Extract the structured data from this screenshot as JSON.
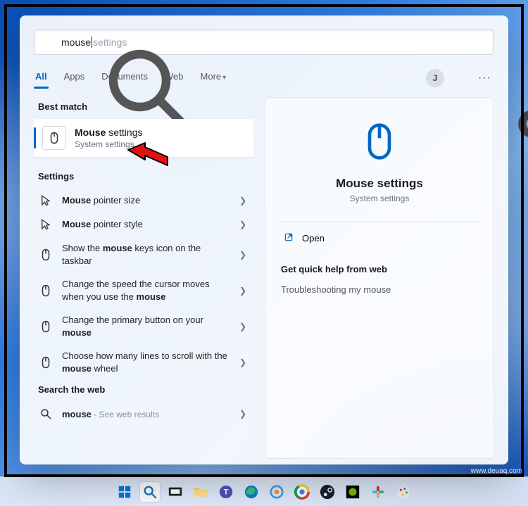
{
  "search": {
    "typed": "mouse",
    "hint_suffix": " settings"
  },
  "tabs": {
    "all": "All",
    "apps": "Apps",
    "documents": "Documents",
    "web": "Web",
    "more": "More"
  },
  "user": {
    "initial": "J"
  },
  "sections": {
    "best_match": "Best match",
    "settings": "Settings",
    "search_web": "Search the web"
  },
  "best_match": {
    "title_bold": "Mouse",
    "title_rest": " settings",
    "subtitle": "System settings"
  },
  "settings_items": [
    {
      "icon": "pointer",
      "pre": "",
      "bold": "Mouse",
      "post": " pointer size"
    },
    {
      "icon": "pointer",
      "pre": "",
      "bold": "Mouse",
      "post": " pointer style"
    },
    {
      "icon": "mouse",
      "pre": "Show the ",
      "bold": "mouse",
      "post": " keys icon on the taskbar"
    },
    {
      "icon": "mouse",
      "pre": "Change the speed the cursor moves when you use the ",
      "bold": "mouse",
      "post": ""
    },
    {
      "icon": "mouse",
      "pre": "Change the primary button on your ",
      "bold": "mouse",
      "post": ""
    },
    {
      "icon": "mouse",
      "pre": "Choose how many lines to scroll with the ",
      "bold": "mouse",
      "post": " wheel"
    }
  ],
  "web_result": {
    "bold": "mouse",
    "suffix": " - See web results"
  },
  "preview": {
    "title": "Mouse settings",
    "subtitle": "System settings",
    "open": "Open",
    "help_header": "Get quick help from web",
    "help_link": "Troubleshooting my mouse"
  },
  "watermark": "www.deuaq.com"
}
